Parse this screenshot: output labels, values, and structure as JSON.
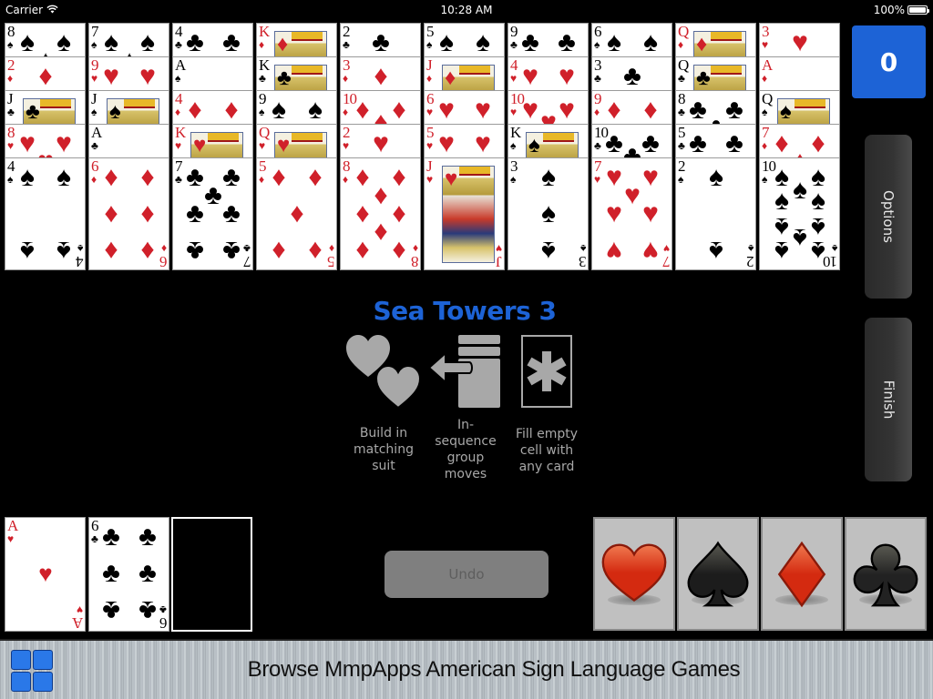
{
  "status_bar": {
    "carrier": "Carrier",
    "time": "10:28 AM",
    "battery": "100%",
    "battery_level": 1.0
  },
  "game": {
    "title": "Sea Towers 3",
    "score": "0",
    "rules": [
      {
        "icon": "matching-suit-hearts-icon",
        "label": "Build in matching suit"
      },
      {
        "icon": "group-move-icon",
        "label": "In-sequence group moves"
      },
      {
        "icon": "wildcard-asterisk-icon",
        "label": "Fill empty cell with any card"
      }
    ]
  },
  "buttons": {
    "options": "Options",
    "finish": "Finish",
    "undo": "Undo",
    "undo_enabled": false
  },
  "tableau": [
    [
      {
        "rank": "8",
        "suit": "spades"
      },
      {
        "rank": "2",
        "suit": "diamonds"
      },
      {
        "rank": "J",
        "suit": "clubs"
      },
      {
        "rank": "8",
        "suit": "hearts"
      },
      {
        "rank": "4",
        "suit": "spades"
      }
    ],
    [
      {
        "rank": "7",
        "suit": "spades"
      },
      {
        "rank": "9",
        "suit": "hearts"
      },
      {
        "rank": "J",
        "suit": "spades"
      },
      {
        "rank": "A",
        "suit": "clubs"
      },
      {
        "rank": "6",
        "suit": "diamonds"
      }
    ],
    [
      {
        "rank": "4",
        "suit": "clubs"
      },
      {
        "rank": "A",
        "suit": "spades"
      },
      {
        "rank": "4",
        "suit": "diamonds"
      },
      {
        "rank": "K",
        "suit": "hearts"
      },
      {
        "rank": "7",
        "suit": "clubs"
      }
    ],
    [
      {
        "rank": "K",
        "suit": "diamonds"
      },
      {
        "rank": "K",
        "suit": "clubs"
      },
      {
        "rank": "9",
        "suit": "spades"
      },
      {
        "rank": "Q",
        "suit": "hearts"
      },
      {
        "rank": "5",
        "suit": "diamonds"
      }
    ],
    [
      {
        "rank": "2",
        "suit": "clubs"
      },
      {
        "rank": "3",
        "suit": "diamonds"
      },
      {
        "rank": "10",
        "suit": "diamonds"
      },
      {
        "rank": "2",
        "suit": "hearts"
      },
      {
        "rank": "8",
        "suit": "diamonds"
      }
    ],
    [
      {
        "rank": "5",
        "suit": "spades"
      },
      {
        "rank": "J",
        "suit": "diamonds"
      },
      {
        "rank": "6",
        "suit": "hearts"
      },
      {
        "rank": "5",
        "suit": "hearts"
      },
      {
        "rank": "J",
        "suit": "hearts"
      }
    ],
    [
      {
        "rank": "9",
        "suit": "clubs"
      },
      {
        "rank": "4",
        "suit": "hearts"
      },
      {
        "rank": "10",
        "suit": "hearts"
      },
      {
        "rank": "K",
        "suit": "spades"
      },
      {
        "rank": "3",
        "suit": "spades"
      }
    ],
    [
      {
        "rank": "6",
        "suit": "spades"
      },
      {
        "rank": "3",
        "suit": "clubs"
      },
      {
        "rank": "9",
        "suit": "diamonds"
      },
      {
        "rank": "10",
        "suit": "clubs"
      },
      {
        "rank": "7",
        "suit": "hearts"
      }
    ],
    [
      {
        "rank": "Q",
        "suit": "diamonds"
      },
      {
        "rank": "Q",
        "suit": "clubs"
      },
      {
        "rank": "8",
        "suit": "clubs"
      },
      {
        "rank": "5",
        "suit": "clubs"
      },
      {
        "rank": "2",
        "suit": "spades"
      }
    ],
    [
      {
        "rank": "3",
        "suit": "hearts"
      },
      {
        "rank": "A",
        "suit": "diamonds"
      },
      {
        "rank": "Q",
        "suit": "spades"
      },
      {
        "rank": "7",
        "suit": "diamonds"
      },
      {
        "rank": "10",
        "suit": "spades"
      }
    ]
  ],
  "freecells": [
    {
      "rank": "A",
      "suit": "hearts"
    },
    {
      "rank": "6",
      "suit": "clubs"
    },
    null
  ],
  "foundations": [
    {
      "suit": "hearts",
      "color": "#d42a10"
    },
    {
      "suit": "spades",
      "color": "#1c1c1c"
    },
    {
      "suit": "diamonds",
      "color": "#d42a10"
    },
    {
      "suit": "clubs",
      "color": "#222222"
    }
  ],
  "suit_symbols": {
    "spades": "♠",
    "hearts": "♥",
    "diamonds": "♦",
    "clubs": "♣"
  },
  "banner": {
    "text": "Browse MmpApps American Sign Language Games",
    "icon": "asl-app-icon"
  }
}
